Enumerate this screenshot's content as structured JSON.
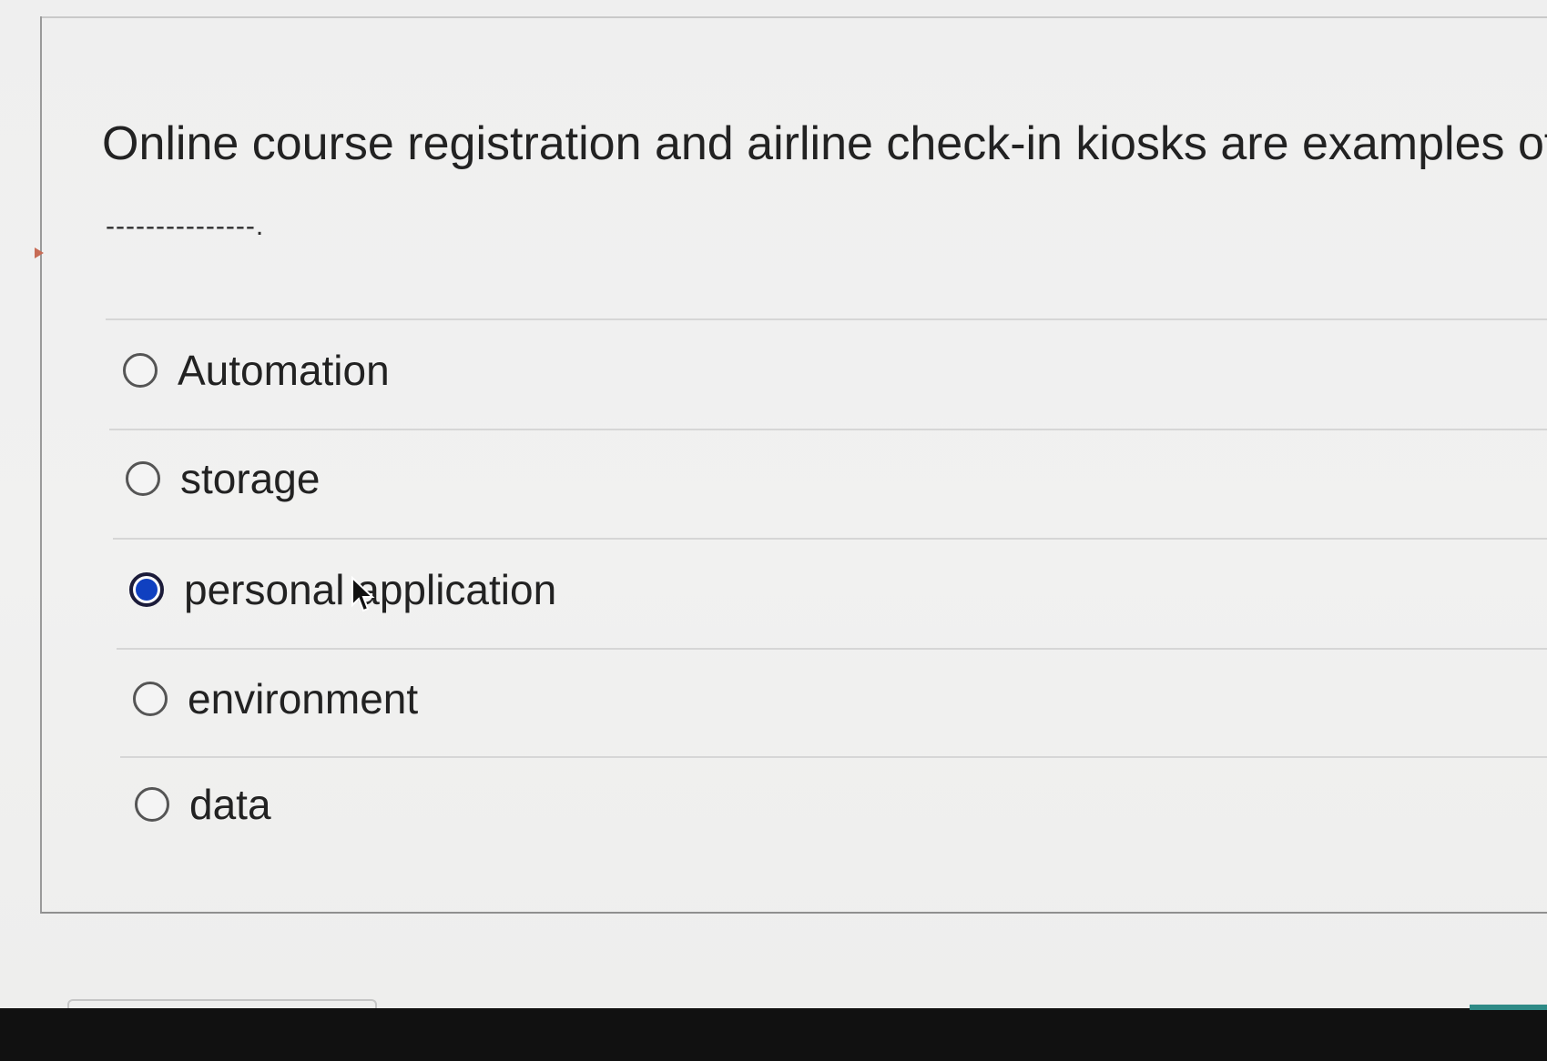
{
  "question": {
    "text": "Online course registration and airline check-in kiosks are examples of",
    "blank": "---------------."
  },
  "options": [
    {
      "label": "Automation",
      "selected": false
    },
    {
      "label": "storage",
      "selected": false
    },
    {
      "label": "personal application",
      "selected": true
    },
    {
      "label": "environment",
      "selected": false
    },
    {
      "label": "data",
      "selected": false
    }
  ],
  "colors": {
    "selected_radio": "#1040c0",
    "page_background": "#efefef"
  },
  "icons": {
    "cursor": "mouse-pointer-icon"
  }
}
